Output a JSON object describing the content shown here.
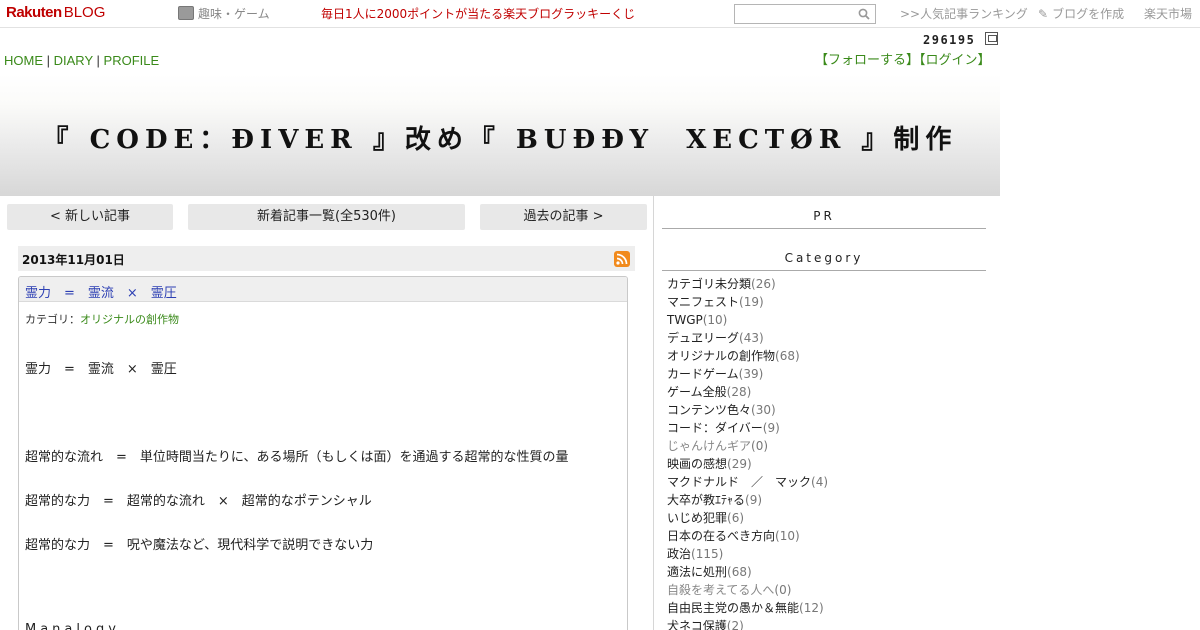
{
  "topbar": {
    "logo_main": "Rakuten",
    "logo_sub": "BLOG",
    "genre": "趣味・ゲーム",
    "lottery": "毎日1人に2000ポイントが当たる楽天ブログラッキーくじ",
    "search_value": "",
    "ranking": ">>人気記事ランキング",
    "create": "ブログを作成",
    "market": "楽天市場"
  },
  "header": {
    "counter": "296195",
    "nav_home": "HOME",
    "nav_diary": "DIARY",
    "nav_profile": "PROFILE",
    "nav_sep": "|",
    "follow": "【フォローする】",
    "login": "【ログイン】",
    "title": "『 CODE：ÐIVER 』改め『 BUÐÐY　XECTØR 』制作"
  },
  "pager": {
    "newer": "< 新しい記事",
    "list": "新着記事一覧(全530件)",
    "older": "過去の記事 >"
  },
  "article": {
    "date": "2013年11月01日",
    "title": "霊力　=　霊流　×　霊圧",
    "category_label": "カテゴリ：",
    "category": "オリジナルの創作物",
    "lines": [
      "霊力　=　霊流　×　霊圧",
      "超常的な流れ　=　単位時間当たりに、ある場所（もしくは面）を通過する超常的な性質の量",
      "超常的な力　=　超常的な流れ　×　超常的なポテンシャル",
      "超常的な力　=　呪や魔法など、現代科学で説明できない力",
      "Manalogy"
    ]
  },
  "sidebar": {
    "pr": "PR",
    "category_head": "Category",
    "categories": [
      {
        "name": "カテゴリ未分類",
        "count": "(26)"
      },
      {
        "name": "マニフェスト",
        "count": "(19)"
      },
      {
        "name": "TWGP",
        "count": "(10)"
      },
      {
        "name": "デュヱリーグ",
        "count": "(43)"
      },
      {
        "name": "オリジナルの創作物",
        "count": "(68)"
      },
      {
        "name": "カードゲーム",
        "count": "(39)"
      },
      {
        "name": "ゲーム全般",
        "count": "(28)"
      },
      {
        "name": "コンテンツ色々",
        "count": "(30)"
      },
      {
        "name": "コード：ダイバー",
        "count": "(9)"
      },
      {
        "name": "じゃんけんギア",
        "count": "(0)"
      },
      {
        "name": "映画の感想",
        "count": "(29)"
      },
      {
        "name": "マクドナルド　／　マック",
        "count": "(4)"
      },
      {
        "name": "大卒が教ｴﾃｬる",
        "count": "(9)"
      },
      {
        "name": "いじめ犯罪",
        "count": "(6)"
      },
      {
        "name": "日本の在るべき方向",
        "count": "(10)"
      },
      {
        "name": "政治",
        "count": "(115)"
      },
      {
        "name": "適法に処刑",
        "count": "(68)"
      },
      {
        "name": "自殺を考えてる人へ",
        "count": "(0)"
      },
      {
        "name": "自由民主党の愚か＆無能",
        "count": "(12)"
      },
      {
        "name": "犬ネコ保護",
        "count": "(2)"
      }
    ]
  }
}
